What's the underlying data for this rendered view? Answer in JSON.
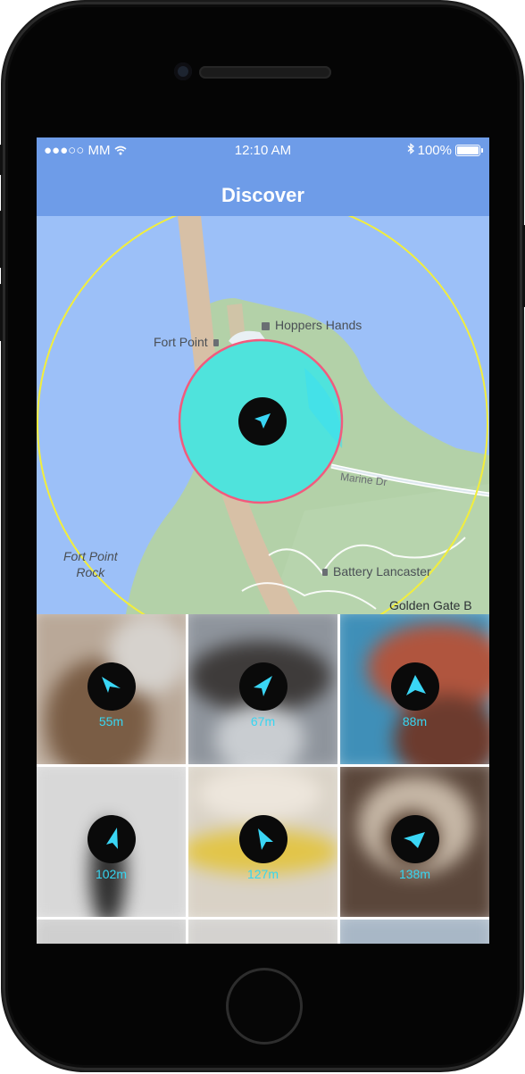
{
  "status_bar": {
    "carrier": "●●●○○ MM",
    "time": "12:10 AM",
    "battery": "100%",
    "icons": [
      "wifi-icon",
      "bluetooth-icon",
      "battery-icon"
    ]
  },
  "nav": {
    "title": "Discover"
  },
  "map": {
    "labels": {
      "hoppers_hands": "Hoppers Hands",
      "fort_point": "Fort Point",
      "fort_point_rock_1": "Fort Point",
      "fort_point_rock_2": "Rock",
      "marine_dr": "Marine Dr",
      "battery_lancaster": "Battery Lancaster",
      "golden_gate": "Golden Gate B"
    },
    "colors": {
      "water": "#9cc0f8",
      "land": "#b3d1a8",
      "road": "#d7c0a6",
      "outer_ring": "#f2ee3c",
      "inner_ring": "#f25a7d",
      "fill": "#4fe3dc"
    }
  },
  "grid": {
    "tiles": [
      {
        "distance": "55m",
        "icon": "navigation-arrow-icon"
      },
      {
        "distance": "67m",
        "icon": "navigation-arrow-icon"
      },
      {
        "distance": "88m",
        "icon": "navigation-arrow-icon"
      },
      {
        "distance": "102m",
        "icon": "navigation-arrow-icon"
      },
      {
        "distance": "127m",
        "icon": "navigation-arrow-icon"
      },
      {
        "distance": "138m",
        "icon": "navigation-arrow-icon"
      }
    ],
    "accent_color": "#36d6f2"
  }
}
